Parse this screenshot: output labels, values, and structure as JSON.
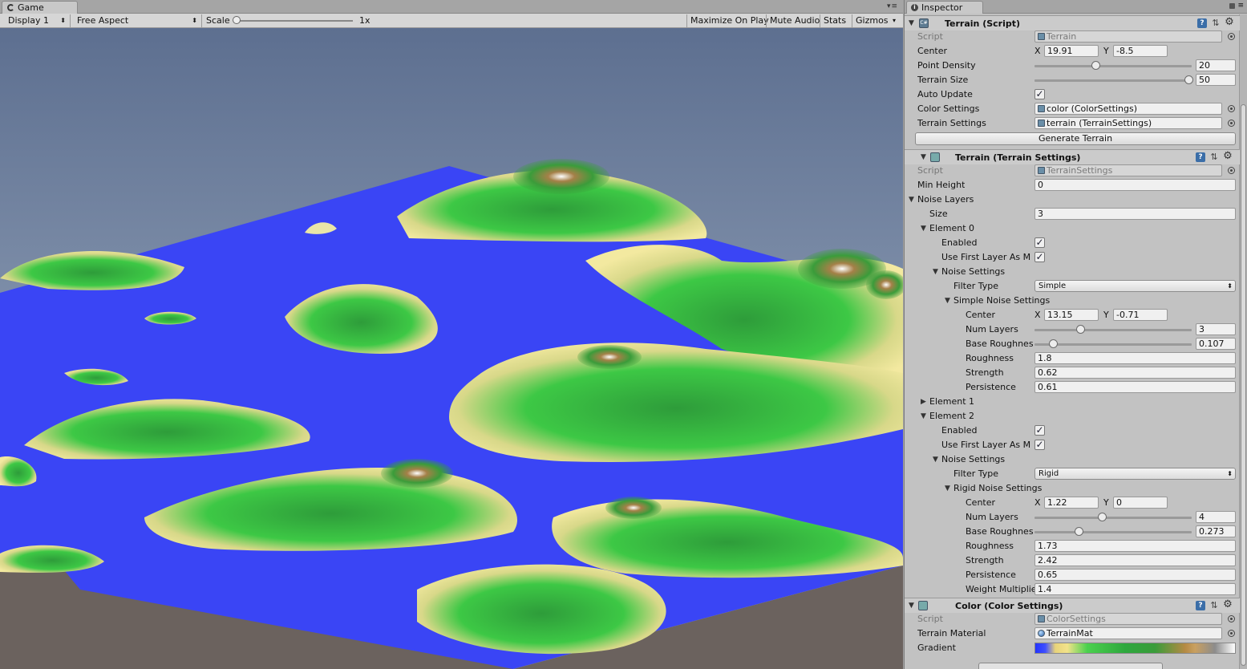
{
  "game": {
    "tab_title": "Game",
    "display": "Display 1",
    "aspect": "Free Aspect",
    "scale_label": "Scale",
    "scale_value": "1x",
    "buttons": [
      "Maximize On Play",
      "Mute Audio",
      "Stats",
      "Gizmos"
    ],
    "colors": {
      "sky_top": "#5c6e8e",
      "sky_bottom": "#c7cfd5",
      "water": "#3a45f5",
      "ground": "#6b625e"
    }
  },
  "inspector": {
    "tab_title": "Inspector",
    "terrain_script": {
      "title": "Terrain (Script)",
      "script_label": "Script",
      "script_value": "Terrain",
      "center_label": "Center",
      "center_x": "19.91",
      "center_y": "-8.5",
      "point_density_label": "Point Density",
      "point_density_value": "20",
      "point_density_fraction": 0.38,
      "terrain_size_label": "Terrain Size",
      "terrain_size_value": "50",
      "terrain_size_fraction": 1.0,
      "auto_update_label": "Auto Update",
      "auto_update_checked": true,
      "color_settings_label": "Color Settings",
      "color_settings_value": "color (ColorSettings)",
      "terrain_settings_label": "Terrain Settings",
      "terrain_settings_value": "terrain (TerrainSettings)",
      "generate_button": "Generate Terrain"
    },
    "terrain_settings": {
      "title": "Terrain (Terrain Settings)",
      "script_label": "Script",
      "script_value": "TerrainSettings",
      "min_height_label": "Min Height",
      "min_height_value": "0",
      "noise_layers_label": "Noise Layers",
      "size_label": "Size",
      "size_value": "3",
      "element0": {
        "label": "Element 0",
        "enabled_label": "Enabled",
        "enabled": true,
        "use_first_label": "Use First Layer As M",
        "use_first": true,
        "noise_settings_label": "Noise Settings",
        "filter_type_label": "Filter Type",
        "filter_type_value": "Simple",
        "sub_label": "Simple Noise Settings",
        "center_label": "Center",
        "center_x": "13.15",
        "center_y": "-0.71",
        "num_layers_label": "Num Layers",
        "num_layers_value": "3",
        "num_layers_fraction": 0.29,
        "base_roughness_label": "Base Roughnes",
        "base_roughness_value": "0.107",
        "base_roughness_fraction": 0.11,
        "roughness_label": "Roughness",
        "roughness_value": "1.8",
        "strength_label": "Strength",
        "strength_value": "0.62",
        "persistence_label": "Persistence",
        "persistence_value": "0.61"
      },
      "element1": {
        "label": "Element 1"
      },
      "element2": {
        "label": "Element 2",
        "enabled_label": "Enabled",
        "enabled": true,
        "use_first_label": "Use First Layer As M",
        "use_first": true,
        "noise_settings_label": "Noise Settings",
        "filter_type_label": "Filter Type",
        "filter_type_value": "Rigid",
        "sub_label": "Rigid Noise Settings",
        "center_label": "Center",
        "center_x": "1.22",
        "center_y": "0",
        "num_layers_label": "Num Layers",
        "num_layers_value": "4",
        "num_layers_fraction": 0.43,
        "base_roughness_label": "Base Roughnes",
        "base_roughness_value": "0.273",
        "base_roughness_fraction": 0.28,
        "roughness_label": "Roughness",
        "roughness_value": "1.73",
        "strength_label": "Strength",
        "strength_value": "2.42",
        "persistence_label": "Persistence",
        "persistence_value": "0.65",
        "weight_label": "Weight Multiplie",
        "weight_value": "1.4"
      }
    },
    "color_settings": {
      "title": "Color (Color Settings)",
      "script_label": "Script",
      "script_value": "ColorSettings",
      "material_label": "Terrain Material",
      "material_value": "TerrainMat",
      "gradient_label": "Gradient"
    }
  }
}
